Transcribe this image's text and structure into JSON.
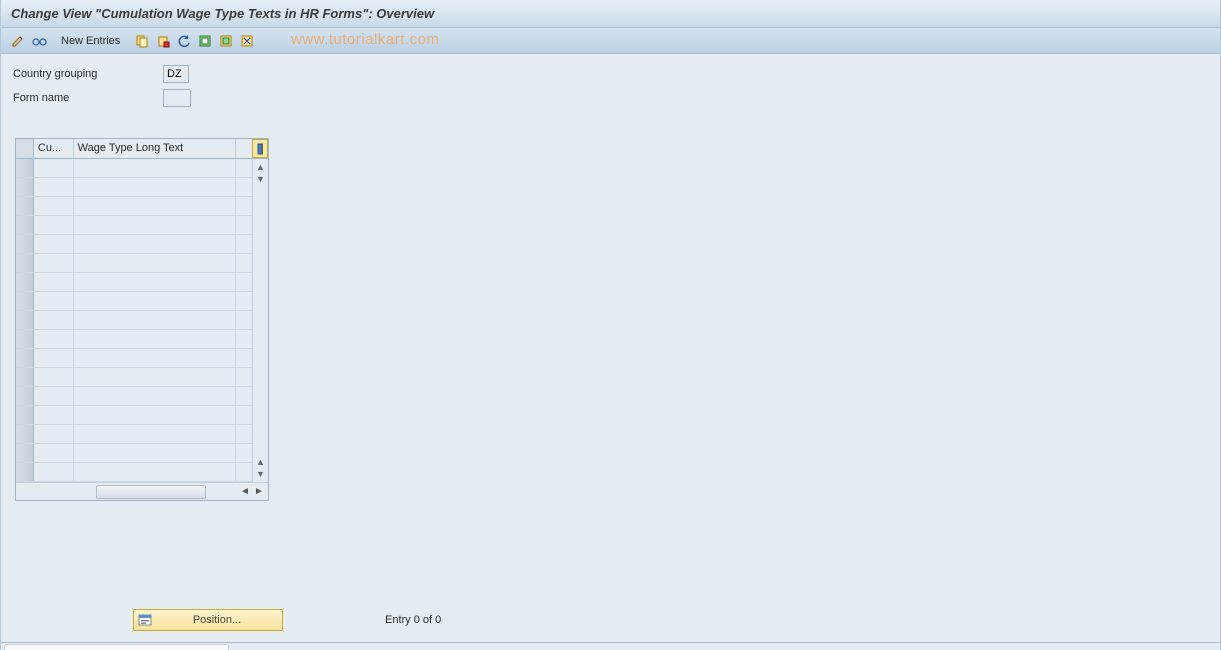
{
  "title": "Change View \"Cumulation Wage Type Texts in HR Forms\": Overview",
  "toolbar": {
    "new_entries": "New Entries"
  },
  "watermark": "www.tutorialkart.com",
  "fields": {
    "country_grouping_label": "Country grouping",
    "country_grouping_value": "DZ",
    "form_name_label": "Form name",
    "form_name_value": ""
  },
  "table": {
    "col1": "Cu...",
    "col2": "Wage Type Long Text",
    "rows": [
      {
        "c1": "",
        "c2": ""
      },
      {
        "c1": "",
        "c2": ""
      },
      {
        "c1": "",
        "c2": ""
      },
      {
        "c1": "",
        "c2": ""
      },
      {
        "c1": "",
        "c2": ""
      },
      {
        "c1": "",
        "c2": ""
      },
      {
        "c1": "",
        "c2": ""
      },
      {
        "c1": "",
        "c2": ""
      },
      {
        "c1": "",
        "c2": ""
      },
      {
        "c1": "",
        "c2": ""
      },
      {
        "c1": "",
        "c2": ""
      },
      {
        "c1": "",
        "c2": ""
      },
      {
        "c1": "",
        "c2": ""
      },
      {
        "c1": "",
        "c2": ""
      },
      {
        "c1": "",
        "c2": ""
      },
      {
        "c1": "",
        "c2": ""
      },
      {
        "c1": "",
        "c2": ""
      }
    ]
  },
  "footer": {
    "position_label": "Position...",
    "entry_text": "Entry 0 of 0"
  }
}
